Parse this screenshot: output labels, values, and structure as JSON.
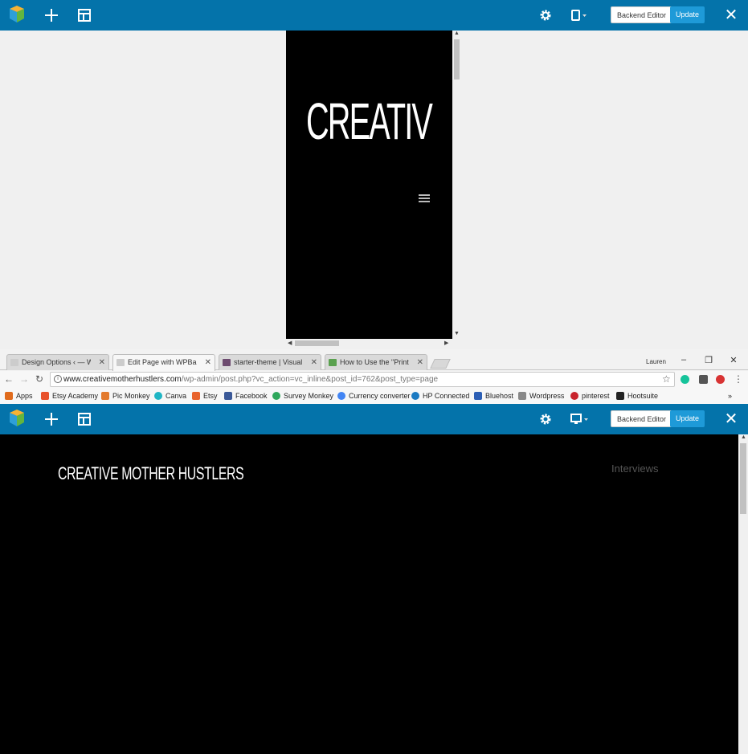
{
  "top_editor": {
    "backend_label": "Backend Editor",
    "update_label": "Update",
    "device": "mobile-icon"
  },
  "top_preview": {
    "site_title": "CREATIV"
  },
  "browser": {
    "tabs": [
      {
        "label": "Design Options ‹ — Wor",
        "favicon": "wpbakery-icon"
      },
      {
        "label": "Edit Page with WPBakery",
        "favicon": "wpbakery-icon",
        "active": true
      },
      {
        "label": "starter-theme | Visual Co",
        "favicon": "hash-icon"
      },
      {
        "label": "How to Use the \"Print Sc",
        "favicon": "doc-icon"
      }
    ],
    "user": "Lauren",
    "url_host": "www.creativemotherhustlers.com",
    "url_path": "/wp-admin/post.php?vc_action=vc_inline&post_id=762&post_type=page",
    "bookmarks": [
      {
        "label": "Apps",
        "icon": "apps-grid-icon",
        "color": "#e06b1d"
      },
      {
        "label": "Etsy Academy",
        "icon": "etsy-academy-icon",
        "color": "#e8522c"
      },
      {
        "label": "Pic Monkey",
        "icon": "picmonkey-icon",
        "color": "#e37a2d"
      },
      {
        "label": "Canva",
        "icon": "canva-icon",
        "color": "#1fb5c4"
      },
      {
        "label": "Etsy",
        "icon": "etsy-icon",
        "color": "#e8632c"
      },
      {
        "label": "Facebook",
        "icon": "facebook-icon",
        "color": "#3b5998"
      },
      {
        "label": "Survey Monkey",
        "icon": "surveymonkey-icon",
        "color": "#2ea75b"
      },
      {
        "label": "Currency converter",
        "icon": "google-icon",
        "color": "#4285f4"
      },
      {
        "label": "HP Connected",
        "icon": "hp-icon",
        "color": "#1b7ac2"
      },
      {
        "label": "Bluehost",
        "icon": "bluehost-icon",
        "color": "#2c5fb5"
      },
      {
        "label": "Wordpress",
        "icon": "wpbakery-icon",
        "color": "#888888"
      },
      {
        "label": "pinterest",
        "icon": "pinterest-icon",
        "color": "#c8232c"
      },
      {
        "label": "Hootsuite",
        "icon": "hootsuite-icon",
        "color": "#222222"
      }
    ],
    "more": "»"
  },
  "bottom_editor": {
    "backend_label": "Backend Editor",
    "update_label": "Update",
    "device": "desktop-icon"
  },
  "bottom_preview": {
    "site_title": "CREATIVE MOTHER HUSTLERS",
    "nav_item": "Interviews"
  },
  "colors": {
    "editor_bar": "#0473aa",
    "update_button": "#1e9ad8",
    "canvas_bg": "#f0f0f0",
    "preview_bg": "#000000"
  }
}
